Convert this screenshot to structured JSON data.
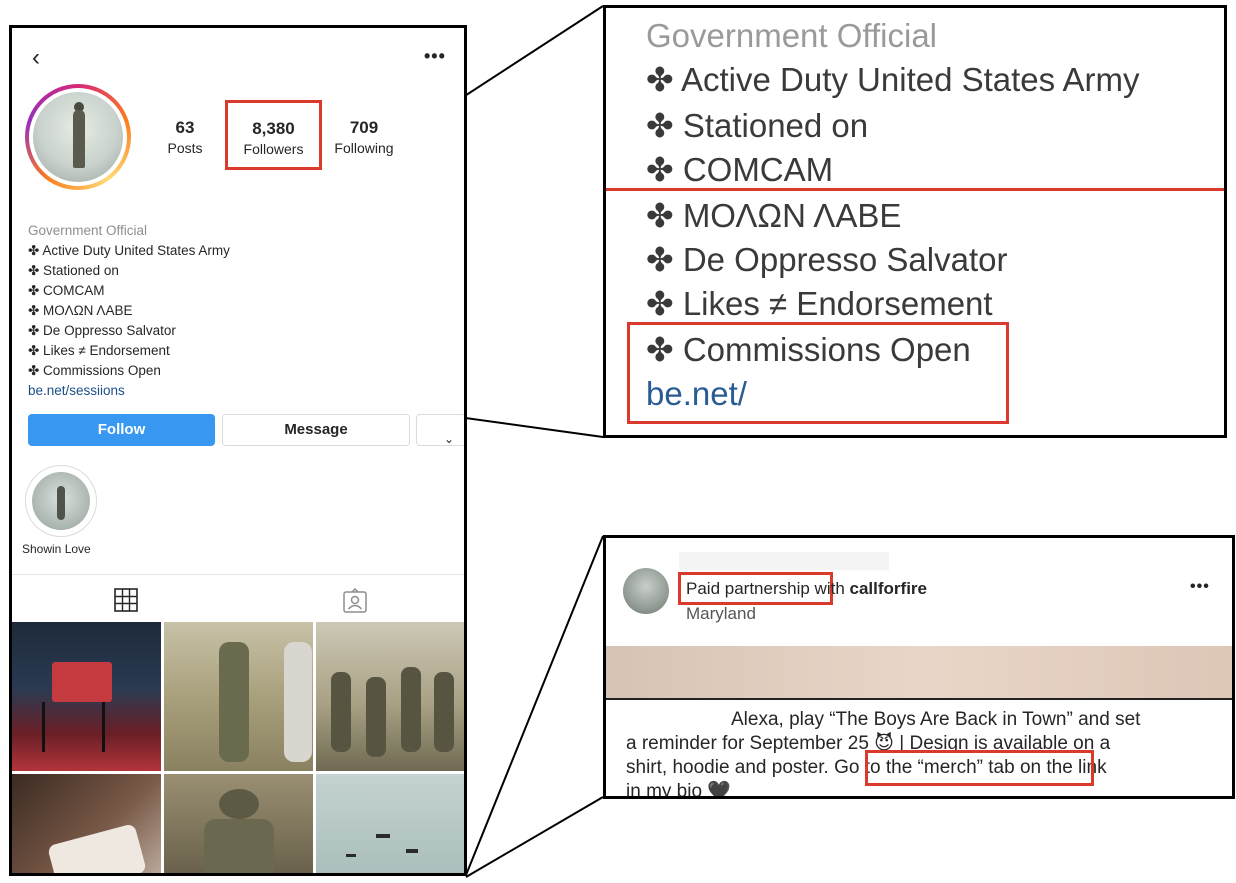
{
  "profile": {
    "back_icon": "chevron-left-icon",
    "more_icon": "ellipsis-icon",
    "stats": [
      {
        "num": "63",
        "label": "Posts"
      },
      {
        "num": "8,380",
        "label": "Followers"
      },
      {
        "num": "709",
        "label": "Following"
      }
    ],
    "bio": {
      "category": "Government Official",
      "lines": [
        "✤ Active Duty United States Army",
        "✤ Stationed on",
        "✤ COMCAM",
        "✤ ΜΟΛΩΝ ΛΑΒΕ",
        "✤ De Oppresso Salvator",
        "✤ Likes ≠ Endorsement",
        "✤ Commissions Open"
      ],
      "link": "be.net/sessiions"
    },
    "buttons": {
      "follow": "Follow",
      "message": "Message"
    },
    "highlight": {
      "label": "Showin Love"
    },
    "tabs": [
      "grid-icon",
      "tagged-icon"
    ]
  },
  "zoom_bio": {
    "category": "Government Official",
    "lines": [
      "✤ Active Duty United States Army",
      "✤ Stationed on",
      "✤ COMCAM",
      "✤ ΜΟΛΩΝ ΛΑΒΕ",
      "✤ De Oppresso Salvator",
      "✤ Likes ≠ Endorsement",
      "✤ Commissions Open"
    ],
    "link": "be.net/"
  },
  "zoom_post": {
    "paid_label": "Paid partnership",
    "with_text": "with",
    "partner": "callforfire",
    "location": "Maryland",
    "more_icon": "ellipsis-icon",
    "caption_line1": "Alexa, play “The Boys Are Back in Town” and set",
    "caption_line2": "a reminder for September 25 😈 | Design is available on a",
    "caption_line3_a": "shirt, hoodie and poster.",
    "caption_line3_b": "Go to the “merch” tab",
    "caption_line3_c": "on the link",
    "caption_line4": "in my bio 🖤"
  },
  "colors": {
    "highlight_box": "#d93a2b",
    "follow_button": "#3897f0",
    "link": "#1c4f87"
  }
}
